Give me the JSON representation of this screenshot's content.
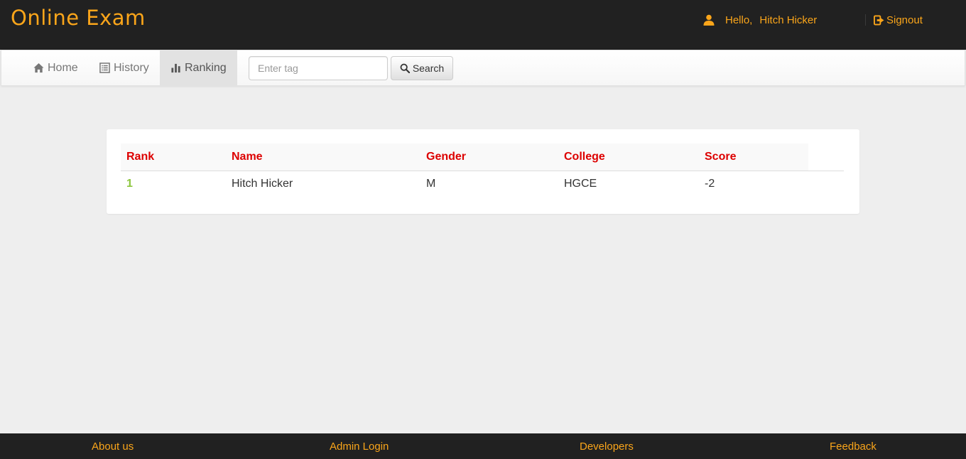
{
  "header": {
    "logo": "Online Exam",
    "greeting": "Hello,",
    "user_name": "Hitch Hicker",
    "signout_label": "Signout",
    "accent_color": "#faa51a"
  },
  "nav": {
    "items": [
      {
        "label": "Home",
        "icon": "home-icon"
      },
      {
        "label": "History",
        "icon": "list-icon"
      },
      {
        "label": "Ranking",
        "icon": "bar-chart-icon",
        "active": true
      }
    ],
    "search": {
      "placeholder": "Enter tag",
      "button_label": "Search"
    }
  },
  "ranking_table": {
    "headers": [
      "Rank",
      "Name",
      "Gender",
      "College",
      "Score"
    ],
    "rows": [
      {
        "rank": "1",
        "name": "Hitch Hicker",
        "gender": "M",
        "college": "HGCE",
        "score": "-2"
      }
    ],
    "header_color": "#dd0000",
    "rank_color": "#8dc63f"
  },
  "footer": {
    "links": [
      "About us",
      "Admin Login",
      "Developers",
      "Feedback"
    ]
  }
}
